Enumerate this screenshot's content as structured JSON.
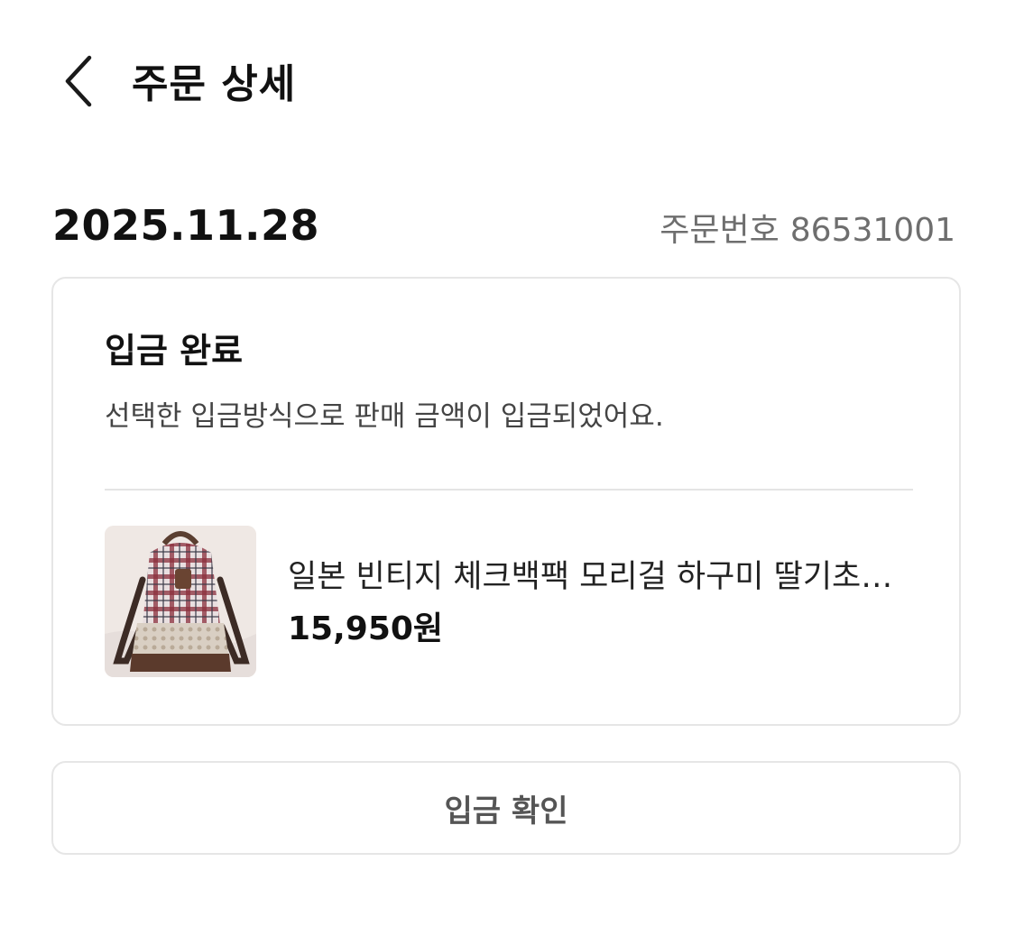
{
  "header": {
    "back_icon": "chevron-left-icon",
    "title": "주문 상세"
  },
  "order": {
    "date": "2025.11.28",
    "number_label": "주문번호",
    "number_value": "86531001"
  },
  "status": {
    "title": "입금 완료",
    "description": "선택한 입금방식으로 판매 금액이 입금되었어요."
  },
  "product": {
    "thumbnail": "plaid-backpack-photo",
    "name": "일본 빈티지 체크백팩 모리걸 하구미 딸기초…",
    "price": "15,950원"
  },
  "actions": {
    "confirm_label": "입금 확인"
  },
  "colors": {
    "text_primary": "#111111",
    "text_secondary": "#6e6e6e",
    "border": "#e6e6e6",
    "button_text": "#555555"
  }
}
